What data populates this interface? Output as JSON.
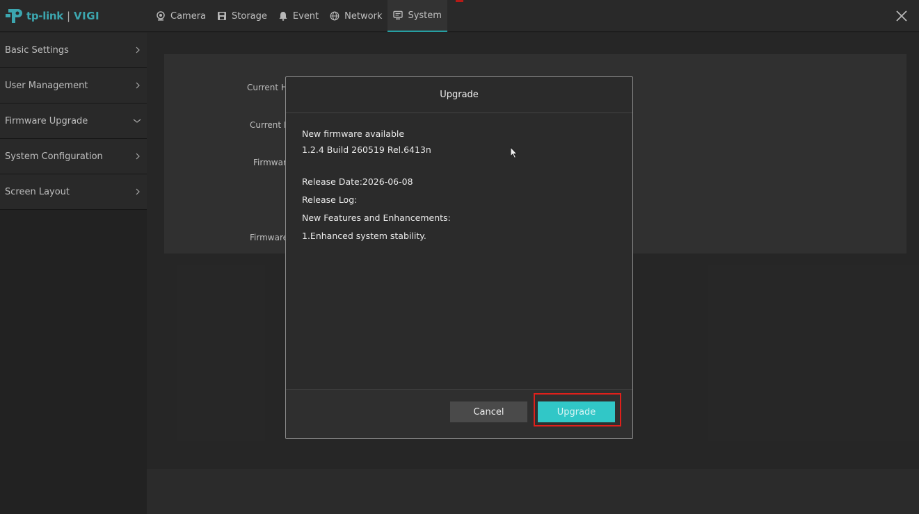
{
  "header": {
    "logo_brand": "tp-link",
    "logo_separator": "|",
    "logo_product": "VIGI",
    "tabs": [
      {
        "label": "Camera",
        "icon": "camera-icon"
      },
      {
        "label": "Storage",
        "icon": "storage-icon"
      },
      {
        "label": "Event",
        "icon": "bell-icon"
      },
      {
        "label": "Network",
        "icon": "globe-icon"
      },
      {
        "label": "System",
        "icon": "monitor-icon",
        "active": true
      }
    ]
  },
  "sidebar": {
    "items": [
      {
        "label": "Basic Settings",
        "icon": "chevron-right-icon"
      },
      {
        "label": "User Management",
        "icon": "chevron-right-icon"
      },
      {
        "label": "Firmware Upgrade",
        "icon": "chevron-down-icon"
      },
      {
        "label": "System Configuration",
        "icon": "chevron-right-icon"
      },
      {
        "label": "Screen Layout",
        "icon": "chevron-right-icon"
      }
    ]
  },
  "background_form": {
    "labels": [
      "Current H",
      "Current I",
      "Firmwar",
      "Firmware"
    ]
  },
  "dialog": {
    "title": "Upgrade",
    "line1": "New firmware available",
    "line2": "1.2.4 Build 260519 Rel.6413n",
    "release_date": "Release Date:2026-06-08",
    "release_log": "Release Log:",
    "features_heading": "New Features and Enhancements:",
    "feature_1": "1.Enhanced system stability.",
    "cancel_label": "Cancel",
    "upgrade_label": "Upgrade"
  },
  "colors": {
    "accent": "#31c7c7",
    "highlight": "#e0201b"
  }
}
